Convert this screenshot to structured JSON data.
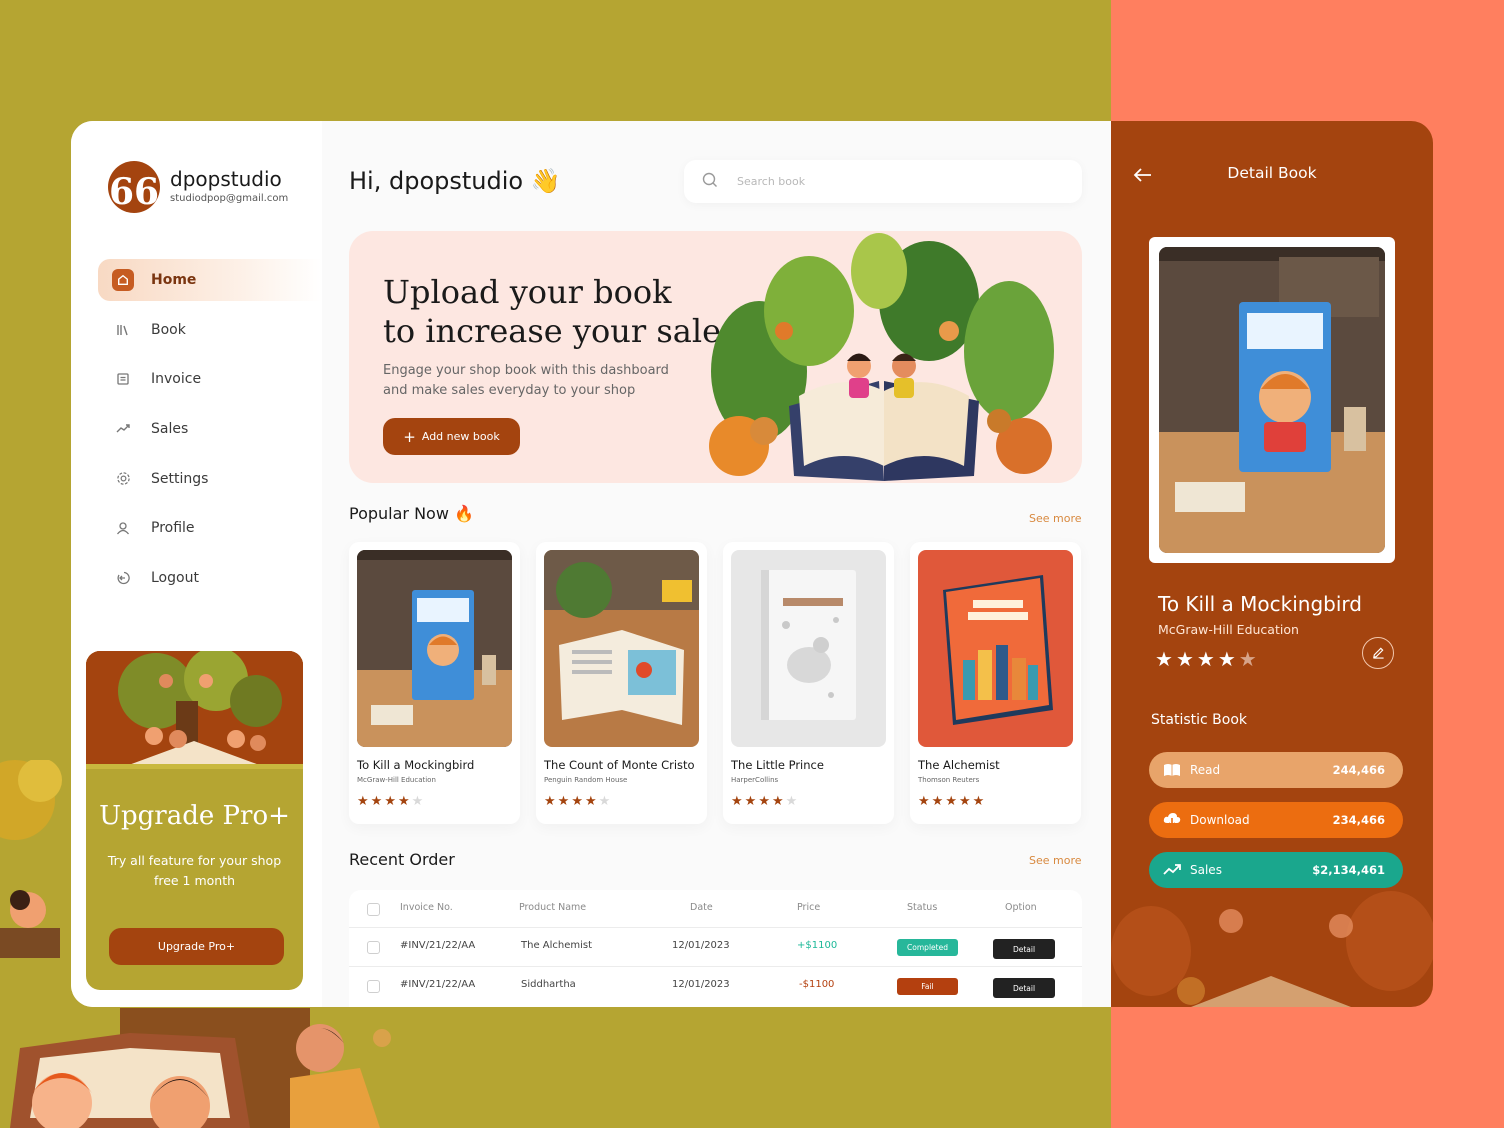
{
  "colors": {
    "brand": "#a4440f",
    "accent_orange": "#ec6d10",
    "teal": "#1aa78d",
    "olive": "#b5a532",
    "coral": "#ff7f5f"
  },
  "user": {
    "name": "dpopstudio",
    "email": "studiodpop@gmail.com",
    "logo_glyph": "66"
  },
  "sidebar": {
    "items": [
      {
        "label": "Home",
        "icon": "home-icon",
        "active": true
      },
      {
        "label": "Book",
        "icon": "books-icon"
      },
      {
        "label": "Invoice",
        "icon": "invoice-icon"
      },
      {
        "label": "Sales",
        "icon": "trend-icon"
      },
      {
        "label": "Settings",
        "icon": "gear-icon"
      },
      {
        "label": "Profile",
        "icon": "user-icon"
      },
      {
        "label": "Logout",
        "icon": "logout-icon"
      }
    ],
    "promo": {
      "title": "Upgrade Pro+",
      "text": "Try all feature for your shop free 1 month",
      "button": "Upgrade Pro+"
    }
  },
  "header": {
    "greeting": "Hi, dpopstudio 👋",
    "search_placeholder": "Search book"
  },
  "hero": {
    "title_line1": "Upload your book",
    "title_line2": "to increase your sales",
    "subtitle": "Engage your shop book with this dashboard and make sales everyday to your shop",
    "button": "Add new book"
  },
  "popular": {
    "title": "Popular Now 🔥",
    "see_more": "See more",
    "books": [
      {
        "title": "To Kill a Mockingbird",
        "publisher": "McGraw-Hill Education",
        "rating": 4
      },
      {
        "title": "The Count of Monte Cristo",
        "publisher": "Penguin Random House",
        "rating": 4
      },
      {
        "title": "The Little Prince",
        "publisher": "HarperCollins",
        "rating": 4
      },
      {
        "title": "The Alchemist",
        "publisher": "Thomson Reuters",
        "rating": 5
      }
    ]
  },
  "orders": {
    "title": "Recent Order",
    "see_more": "See more",
    "columns": [
      "Invoice No.",
      "Product Name",
      "Date",
      "Price",
      "Status",
      "Option"
    ],
    "rows": [
      {
        "invoice": "#INV/21/22/AA",
        "product": "The Alchemist",
        "date": "12/01/2023",
        "price": "+$1100",
        "status": "Completed",
        "option": "Detail"
      },
      {
        "invoice": "#INV/21/22/AA",
        "product": "Siddhartha",
        "date": "12/01/2023",
        "price": "-$1100",
        "status": "Fail",
        "option": "Detail"
      }
    ]
  },
  "detail": {
    "header": "Detail Book",
    "book_title": "To Kill a Mockingbird",
    "publisher": "McGraw-Hill Education",
    "rating": 4,
    "stat_title": "Statistic Book",
    "stats": [
      {
        "label": "Read",
        "value": "244,466",
        "icon": "book-open-icon"
      },
      {
        "label": "Download",
        "value": "234,466",
        "icon": "download-cloud-icon"
      },
      {
        "label": "Sales",
        "value": "$2,134,461",
        "icon": "trend-up-icon"
      }
    ]
  }
}
